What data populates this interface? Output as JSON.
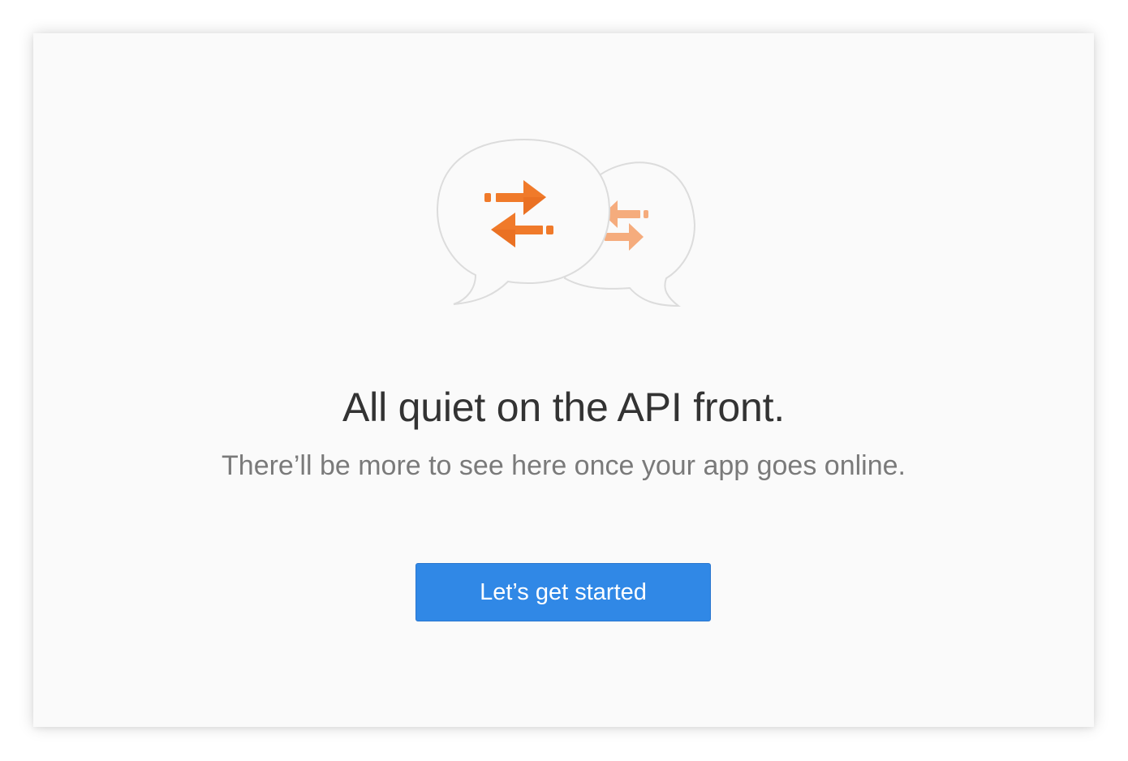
{
  "empty_state": {
    "illustration": {
      "name": "api-chat-bubbles-illustration",
      "icons": [
        "swap-arrows-icon",
        "swap-arrows-icon"
      ]
    },
    "heading": "All quiet on the API front.",
    "subheading": "There’ll be more to see here once your app goes online.",
    "cta_label": "Let’s get started"
  },
  "colors": {
    "background": "#fafafa",
    "heading": "#333333",
    "subheading": "#7a7a7a",
    "accent_orange": "#f07a2a",
    "accent_orange_light": "#f5a877",
    "button_blue": "#3088e6",
    "bubble_stroke": "#dcdcdc"
  }
}
